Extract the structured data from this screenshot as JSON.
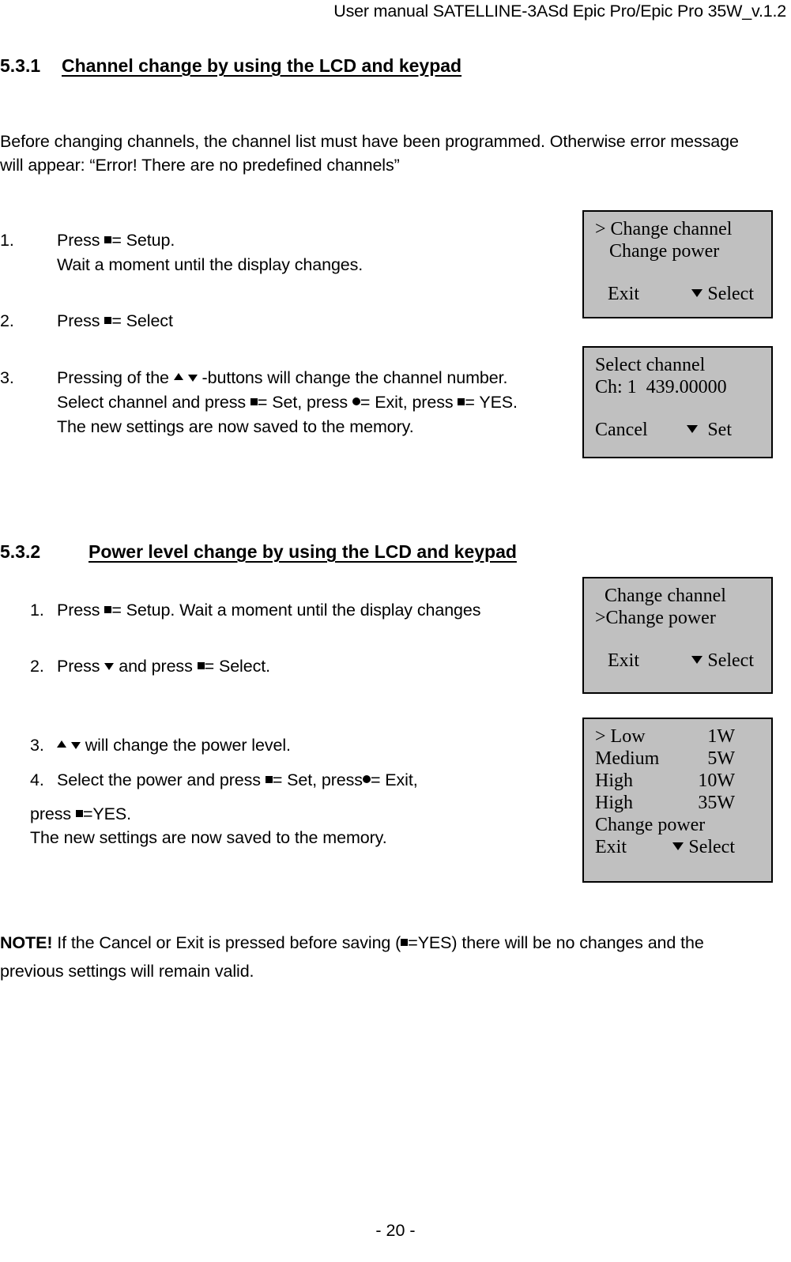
{
  "header": {
    "title": "User manual SATELLINE-3ASd Epic Pro/Epic Pro 35W_v.1.2"
  },
  "footer": {
    "page_label": "- 20 -"
  },
  "sections": [
    {
      "number": "5.3.1",
      "title": "Channel change by using the LCD and keypad",
      "intro": "Before changing channels, the channel list must have been programmed. Otherwise error message will appear: “Error! There are no predefined channels”",
      "steps": [
        {
          "marker": "1.",
          "line1_pre": "Press  ",
          "line1_icon": "square-button-icon",
          "line1_post": "= Setup.",
          "line2": "Wait a moment until the display changes."
        },
        {
          "marker": "2.",
          "line1_pre": "Press  ",
          "line1_icon": "square-button-icon",
          "line1_post": "= Select"
        },
        {
          "marker": "3.",
          "line1_pre": "Pressing of the ",
          "line1_post": "-buttons will change the channel number.",
          "line2_a": "Select channel and press ",
          "line2_b": "= Set, press ",
          "line2_c": "= Exit, press ",
          "line2_d": "= YES.",
          "line3": "The new settings are now saved to the memory."
        }
      ]
    },
    {
      "number": "5.3.2",
      "title": "Power level change by using the LCD and keypad",
      "steps": [
        {
          "marker": "1.",
          "line1_pre": "Press  ",
          "line1_post": "= Setup. Wait a moment until the display changes"
        },
        {
          "marker": "2.",
          "line1_pre": "Press  ",
          "line1_mid": " and press ",
          "line1_post": "= Select."
        },
        {
          "marker": "3.",
          "line1_post": "will change the power level."
        },
        {
          "marker": "4.",
          "line1_a": "Select the power and press ",
          "line1_b": "= Set, press",
          "line1_c": "= Exit,"
        }
      ],
      "yes_line_pre": "press ",
      "yes_line_post": "=YES.",
      "memory_line": "The new settings are now saved to the memory."
    }
  ],
  "note": {
    "lead": "NOTE!",
    "text_a": " If the Cancel or Exit is pressed before saving (",
    "text_b": "=YES) there will be no changes and the previous settings will remain valid."
  },
  "lcd_screens": [
    {
      "id": "change-channel-menu",
      "rows": [
        {
          "left": "> Change channel",
          "right": ""
        },
        {
          "left": "   Change power",
          "right": ""
        }
      ],
      "footer": {
        "left": "Exit",
        "arrow": "down-arrow-icon",
        "right": "Select"
      }
    },
    {
      "id": "select-channel-screen",
      "rows": [
        {
          "left": "Select channel",
          "right": ""
        },
        {
          "left": "Ch: 1  439.00000",
          "right": ""
        }
      ],
      "footer": {
        "left": "Cancel",
        "arrow": "down-arrow-icon",
        "right": "Set"
      }
    },
    {
      "id": "change-power-menu",
      "rows": [
        {
          "left": "  Change channel",
          "right": ""
        },
        {
          "left": ">Change power",
          "right": ""
        }
      ],
      "footer": {
        "left": "Exit",
        "arrow": "down-arrow-icon",
        "right": "Select"
      }
    },
    {
      "id": "power-level-list",
      "rows": [
        {
          "left": "> Low",
          "right": "1W"
        },
        {
          "left": "Medium",
          "right": "5W"
        },
        {
          "left": "High",
          "right": "10W"
        },
        {
          "left": "High",
          "right": "35W"
        },
        {
          "left": "Change power",
          "right": ""
        }
      ],
      "footer": {
        "left": "Exit",
        "arrow": "down-arrow-icon",
        "right": "Select"
      }
    }
  ],
  "colors": {
    "lcd_background": "#c0c0c0",
    "lcd_border": "#000000",
    "text": "#000000",
    "page_background": "#ffffff"
  }
}
